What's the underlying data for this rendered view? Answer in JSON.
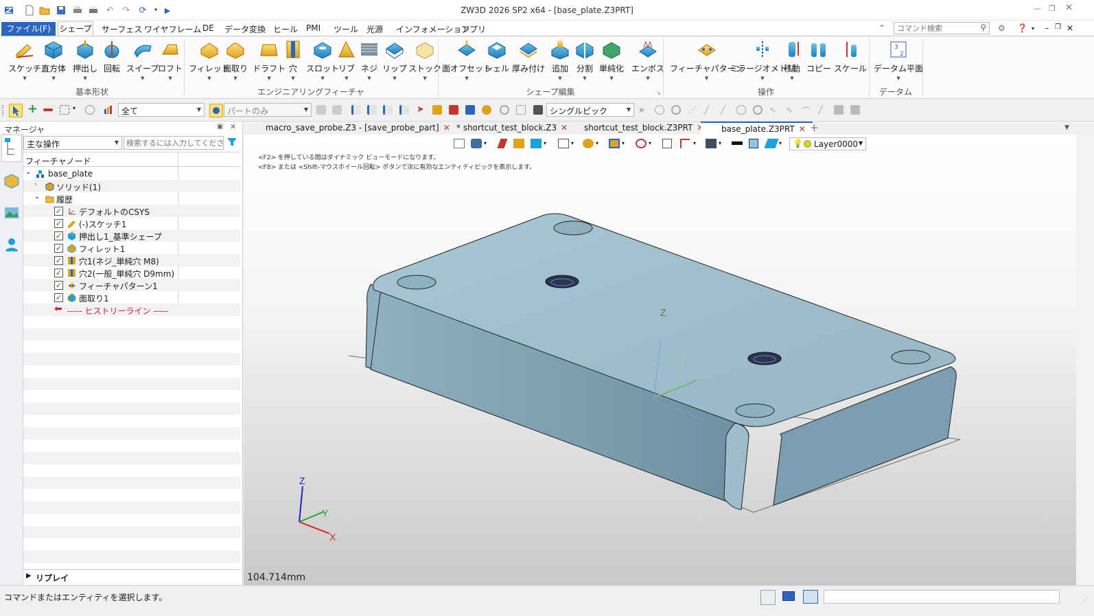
{
  "app_title": "ZW3D 2026 SP2 x64  - [base_plate.Z3PRT]",
  "menu": {
    "file": "ファイル(F)",
    "tabs": [
      "シェープ",
      "サーフェス",
      "ワイヤフレーム",
      "DE",
      "データ変換",
      "ヒール",
      "PMI",
      "ツール",
      "光源",
      "インフォメーション",
      "アプリ"
    ]
  },
  "command_search_placeholder": "コマンド検索",
  "ribbon": {
    "basic": {
      "label": "基本形状",
      "buttons": [
        "スケッチ",
        "直方体",
        "押出し",
        "回転",
        "スイープ",
        "ロフト"
      ]
    },
    "eng": {
      "label": "エンジニアリングフィーチャ",
      "buttons": [
        "フィレット",
        "面取り",
        "ドラフト",
        "穴",
        "スロット",
        "リブ",
        "ネジ",
        "リップ",
        "ストック"
      ]
    },
    "shape_edit": {
      "label": "シェープ編集",
      "buttons": [
        "面オフセット",
        "シェル",
        "厚み付け",
        "追加",
        "分割",
        "単純化",
        "エンボス"
      ]
    },
    "ops": {
      "label": "操作",
      "buttons": [
        "フィーチャパターン",
        "ミラージオメトリ",
        "移動",
        "コピー",
        "スケール"
      ]
    },
    "datum": {
      "label": "データム",
      "buttons": [
        "データム平面"
      ]
    }
  },
  "toolbar": {
    "filter_all": "全て",
    "part_only": "パートのみ",
    "pick_mode": "シングルピック"
  },
  "manager": {
    "title": "マネージャ",
    "combo": "主な操作",
    "search_placeholder": "検索するには入力してください",
    "column_header": "フィーチャノード",
    "tree": [
      {
        "label": "base_plate"
      },
      {
        "label": "ソリッド(1)"
      },
      {
        "label": "履歴"
      },
      {
        "label": "デフォルトのCSYS"
      },
      {
        "label": "(-)スケッチ1"
      },
      {
        "label": "押出し1_基準シェープ"
      },
      {
        "label": "フィレット1"
      },
      {
        "label": "穴1(ネジ_単純穴 M8)"
      },
      {
        "label": "穴2(一般_単純穴 D9mm)"
      },
      {
        "label": "フィーチャパターン1"
      },
      {
        "label": "面取り1"
      },
      {
        "label": "----- ヒストリーライン -----"
      }
    ],
    "replay": "リプレイ"
  },
  "doc_tabs": [
    {
      "label": "macro_save_probe.Z3 - [save_probe_part]"
    },
    {
      "label": "* shortcut_test_block.Z3"
    },
    {
      "label": "shortcut_test_block.Z3PRT"
    },
    {
      "label": "base_plate.Z3PRT"
    }
  ],
  "viewport": {
    "hint1": "<F2> を押している間はダイナミック ビューモードになります。",
    "hint2": "<F8> または <Shift-マウスホイール回転> ボタンで次に有効なエンティティピックを表示します。",
    "layer": "Layer0000",
    "measure": "104.714mm",
    "axis_x": "X",
    "axis_y": "Y",
    "axis_z": "Z"
  },
  "status_text": "コマンドまたはエンティティを選択します。",
  "colors": {
    "accent": "#2a65bf",
    "part": "#9dbccc",
    "part_side": "#7f9fb0",
    "history_line": "#d0202a"
  }
}
